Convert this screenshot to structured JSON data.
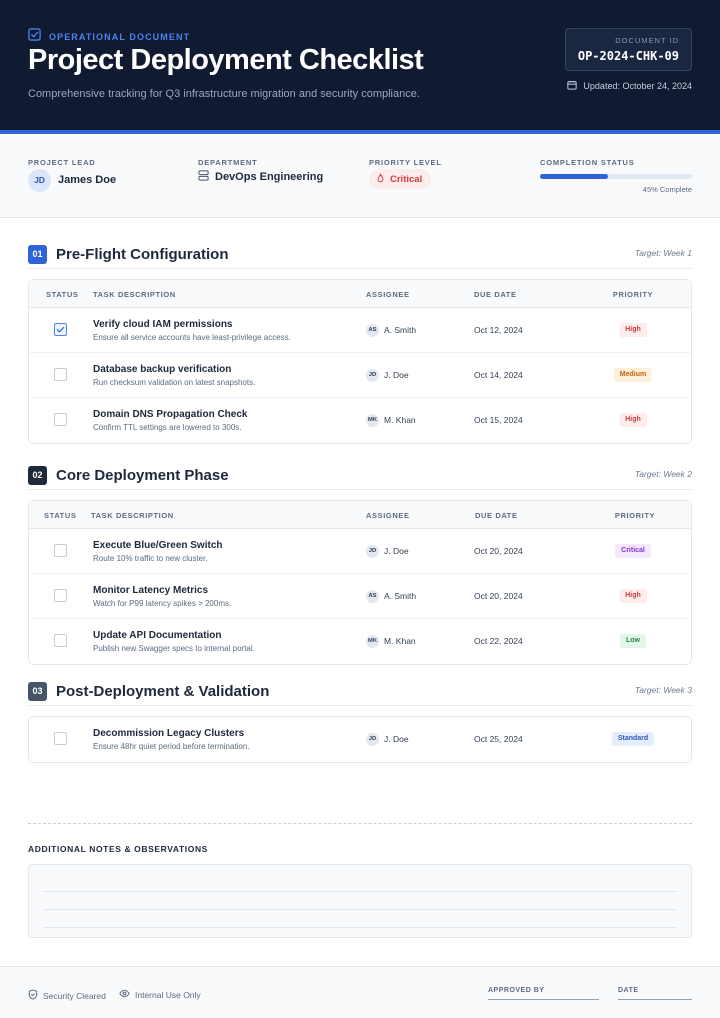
{
  "header": {
    "kicker": "OPERATIONAL DOCUMENT",
    "title": "Project Deployment Checklist",
    "subtitle": "Comprehensive tracking for Q3 infrastructure migration and security compliance.",
    "doc_id_label": "DOCUMENT ID",
    "doc_id": "OP-2024-CHK-09",
    "updated": "Updated: October 24, 2024"
  },
  "meta": {
    "lead_label": "PROJECT LEAD",
    "lead_initials": "JD",
    "lead_name": "James Doe",
    "dept_label": "DEPARTMENT",
    "dept": "DevOps Engineering",
    "priority_label": "PRIORITY LEVEL",
    "priority": "Critical",
    "completion_label": "COMPLETION STATUS",
    "completion_percent": 45,
    "completion_text": "45% Complete"
  },
  "columns": {
    "status": "STATUS",
    "task": "TASK DESCRIPTION",
    "assignee": "ASSIGNEE",
    "due": "DUE DATE",
    "priority": "PRIORITY"
  },
  "sections": [
    {
      "num": "01",
      "title": "Pre-Flight Configuration",
      "target": "Target: Week 1",
      "color": "#2f63d8",
      "tasks": [
        {
          "checked": true,
          "title": "Verify cloud IAM permissions",
          "desc": "Ensure all service accounts have least-privilege access.",
          "initials": "AS",
          "assignee": "A. Smith",
          "due": "Oct 12, 2024",
          "priority": "High"
        },
        {
          "checked": false,
          "title": "Database backup verification",
          "desc": "Run checksum validation on latest snapshots.",
          "initials": "JD",
          "assignee": "J. Doe",
          "due": "Oct 14, 2024",
          "priority": "Medium"
        },
        {
          "checked": false,
          "title": "Domain DNS Propagation Check",
          "desc": "Confirm TTL settings are lowered to 300s.",
          "initials": "MK",
          "assignee": "M. Khan",
          "due": "Oct 15, 2024",
          "priority": "High"
        }
      ]
    },
    {
      "num": "02",
      "title": "Core Deployment Phase",
      "target": "Target: Week 2",
      "color": "#1e293b",
      "tasks": [
        {
          "checked": false,
          "title": "Execute Blue/Green Switch",
          "desc": "Route 10% traffic to new cluster.",
          "initials": "JD",
          "assignee": "J. Doe",
          "due": "Oct 20, 2024",
          "priority": "Critical"
        },
        {
          "checked": false,
          "title": "Monitor Latency Metrics",
          "desc": "Watch for P99 latency spikes > 200ms.",
          "initials": "AS",
          "assignee": "A. Smith",
          "due": "Oct 20, 2024",
          "priority": "High"
        },
        {
          "checked": false,
          "title": "Update API Documentation",
          "desc": "Publish new Swagger specs to internal portal.",
          "initials": "MK",
          "assignee": "M. Khan",
          "due": "Oct 22, 2024",
          "priority": "Low"
        }
      ]
    },
    {
      "num": "03",
      "title": "Post-Deployment & Validation",
      "target": "Target: Week 3",
      "color": "#475569",
      "tasks": [
        {
          "checked": false,
          "title": "Decommission Legacy Clusters",
          "desc": "Ensure 48hr quiet period before termination.",
          "initials": "JD",
          "assignee": "J. Doe",
          "due": "Oct 25, 2024",
          "priority": "Standard"
        }
      ]
    }
  ],
  "priority_colors": {
    "High": {
      "bg": "#fdecec",
      "fg": "#d23c3c"
    },
    "Medium": {
      "bg": "#fdf1dc",
      "fg": "#c2620c"
    },
    "Critical": {
      "bg": "#f4e8fd",
      "fg": "#8a35c9"
    },
    "Low": {
      "bg": "#e3f7e9",
      "fg": "#1f8a45"
    },
    "Standard": {
      "bg": "#e3edfd",
      "fg": "#2f58b8"
    }
  },
  "notes": {
    "label": "ADDITIONAL NOTES & OBSERVATIONS"
  },
  "footer": {
    "security": "Security Cleared",
    "internal": "Internal Use Only",
    "approved_by": "APPROVED BY",
    "date": "DATE"
  }
}
